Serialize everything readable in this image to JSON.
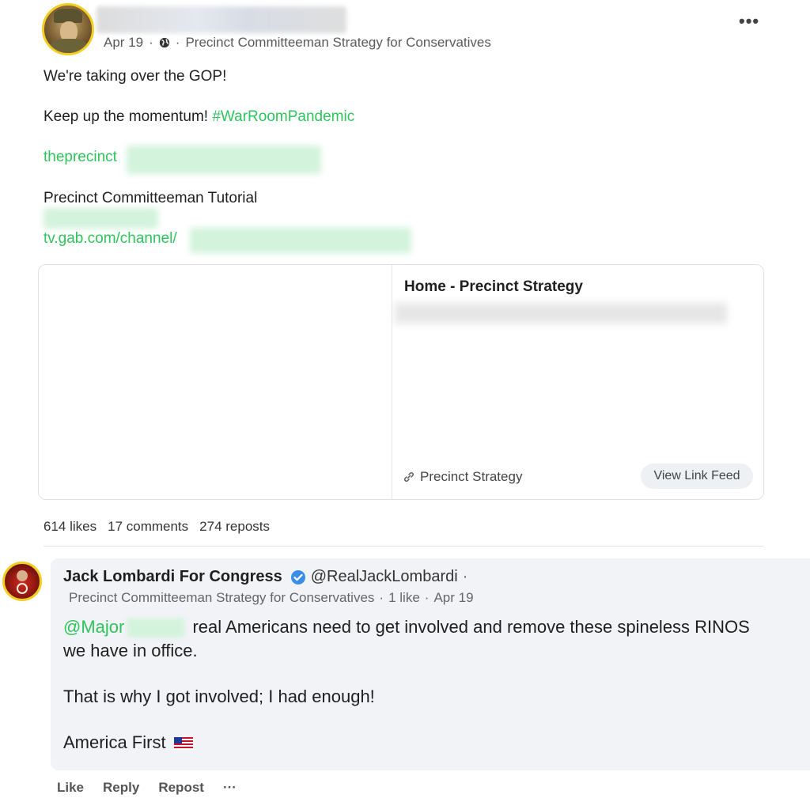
{
  "post": {
    "date": "Apr 19",
    "group": "Precinct Committeeman Strategy for Conservatives",
    "line1": "We're taking over the GOP!",
    "line2_text": "Keep up the momentum!",
    "line2_hashtag": "#WarRoomPandemic",
    "link1": "theprecinct",
    "tutorial": "Precinct Committeeman Tutorial",
    "link2": "tv.gab.com/channel/",
    "icons": {
      "more": "more-options-icon",
      "visibility": "globe-icon"
    }
  },
  "card": {
    "title": "Home - Precinct Strategy",
    "link_label": "Precinct Strategy",
    "view_button": "View Link Feed"
  },
  "stats": {
    "likes": "614 likes",
    "comments": "17 comments",
    "reposts": "274 reposts"
  },
  "reply": {
    "name": "Jack Lombardi For Congress",
    "handle": "@RealJackLombardi",
    "handle_sep": "·",
    "group": "Precinct Committeeman Strategy for Conservatives",
    "likes": "1 like",
    "date": "Apr 19",
    "mention": "@Major",
    "text1": "real Americans need to get involved and remove these spineless RINOS",
    "text2": "we have in office.",
    "text3": "That is why I got involved; I had enough!",
    "text4": "America First",
    "verified_color": "#3a8ee6"
  },
  "actions": {
    "like": "Like",
    "reply": "Reply",
    "repost": "Repost",
    "more": "···"
  },
  "colors": {
    "accent_green": "#2ec45c",
    "avatar_ring": "#f3cd20"
  }
}
